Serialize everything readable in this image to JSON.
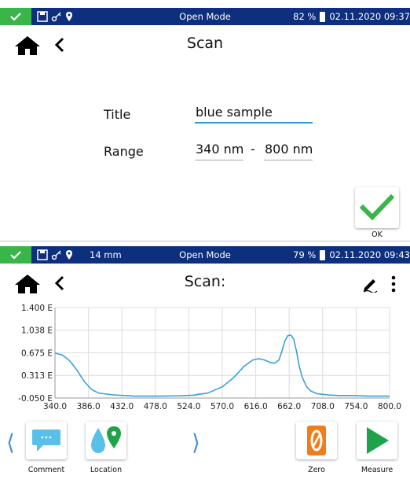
{
  "top_screen": {
    "status": {
      "mode": "Open Mode",
      "battery": "82 %",
      "datetime": "02.11.2020 09:37"
    },
    "title": "Scan",
    "form": {
      "title_label": "Title",
      "title_value": "blue sample",
      "range_label": "Range",
      "range_from": "340 nm",
      "range_sep": "-",
      "range_to": "800 nm"
    },
    "ok_label": "OK"
  },
  "bottom_screen": {
    "status": {
      "extra": "14 mm",
      "mode": "Open Mode",
      "battery": "79 %",
      "datetime": "02.11.2020 09:43"
    },
    "title": "Scan:",
    "toolbar": {
      "comment_label": "Comment",
      "location_label": "Location",
      "zero_label": "Zero",
      "measure_label": "Measure"
    }
  },
  "colors": {
    "status_bg": "#0d2f7e",
    "status_check": "#39b54a",
    "accent_blue": "#2f97cf",
    "ok_green": "#39b54a",
    "zero_orange": "#f07d1a",
    "measure_green": "#1fa34a",
    "curve": "#3aa0d8"
  },
  "chart_data": {
    "type": "line",
    "xlim": [
      340,
      800
    ],
    "ylim": [
      -0.05,
      1.4
    ],
    "x_ticks": [
      "340.0",
      "386.0",
      "432.0",
      "478.0",
      "524.0",
      "570.0",
      "616.0",
      "662.0",
      "708.0",
      "754.0",
      "800.0"
    ],
    "y_ticks": [
      "1.400 E",
      "1.038 E",
      "0.675 E",
      "0.313 E",
      "-0.050 E"
    ],
    "grid": true,
    "series": [
      {
        "x": [
          340,
          350,
          360,
          370,
          380,
          390,
          400,
          420,
          450,
          480,
          510,
          530,
          550,
          570,
          585,
          600,
          612,
          620,
          628,
          636,
          642,
          648,
          652,
          656,
          660,
          664,
          668,
          672,
          676,
          680,
          686,
          692,
          700,
          715,
          730,
          750,
          770,
          800
        ],
        "y": [
          0.67,
          0.64,
          0.55,
          0.4,
          0.22,
          0.09,
          0.03,
          0.0,
          -0.02,
          -0.02,
          -0.015,
          -0.005,
          0.03,
          0.13,
          0.27,
          0.46,
          0.56,
          0.58,
          0.56,
          0.52,
          0.51,
          0.56,
          0.7,
          0.86,
          0.95,
          0.96,
          0.9,
          0.7,
          0.45,
          0.28,
          0.13,
          0.06,
          0.02,
          0.0,
          -0.01,
          -0.01,
          -0.02,
          -0.02
        ]
      }
    ]
  }
}
